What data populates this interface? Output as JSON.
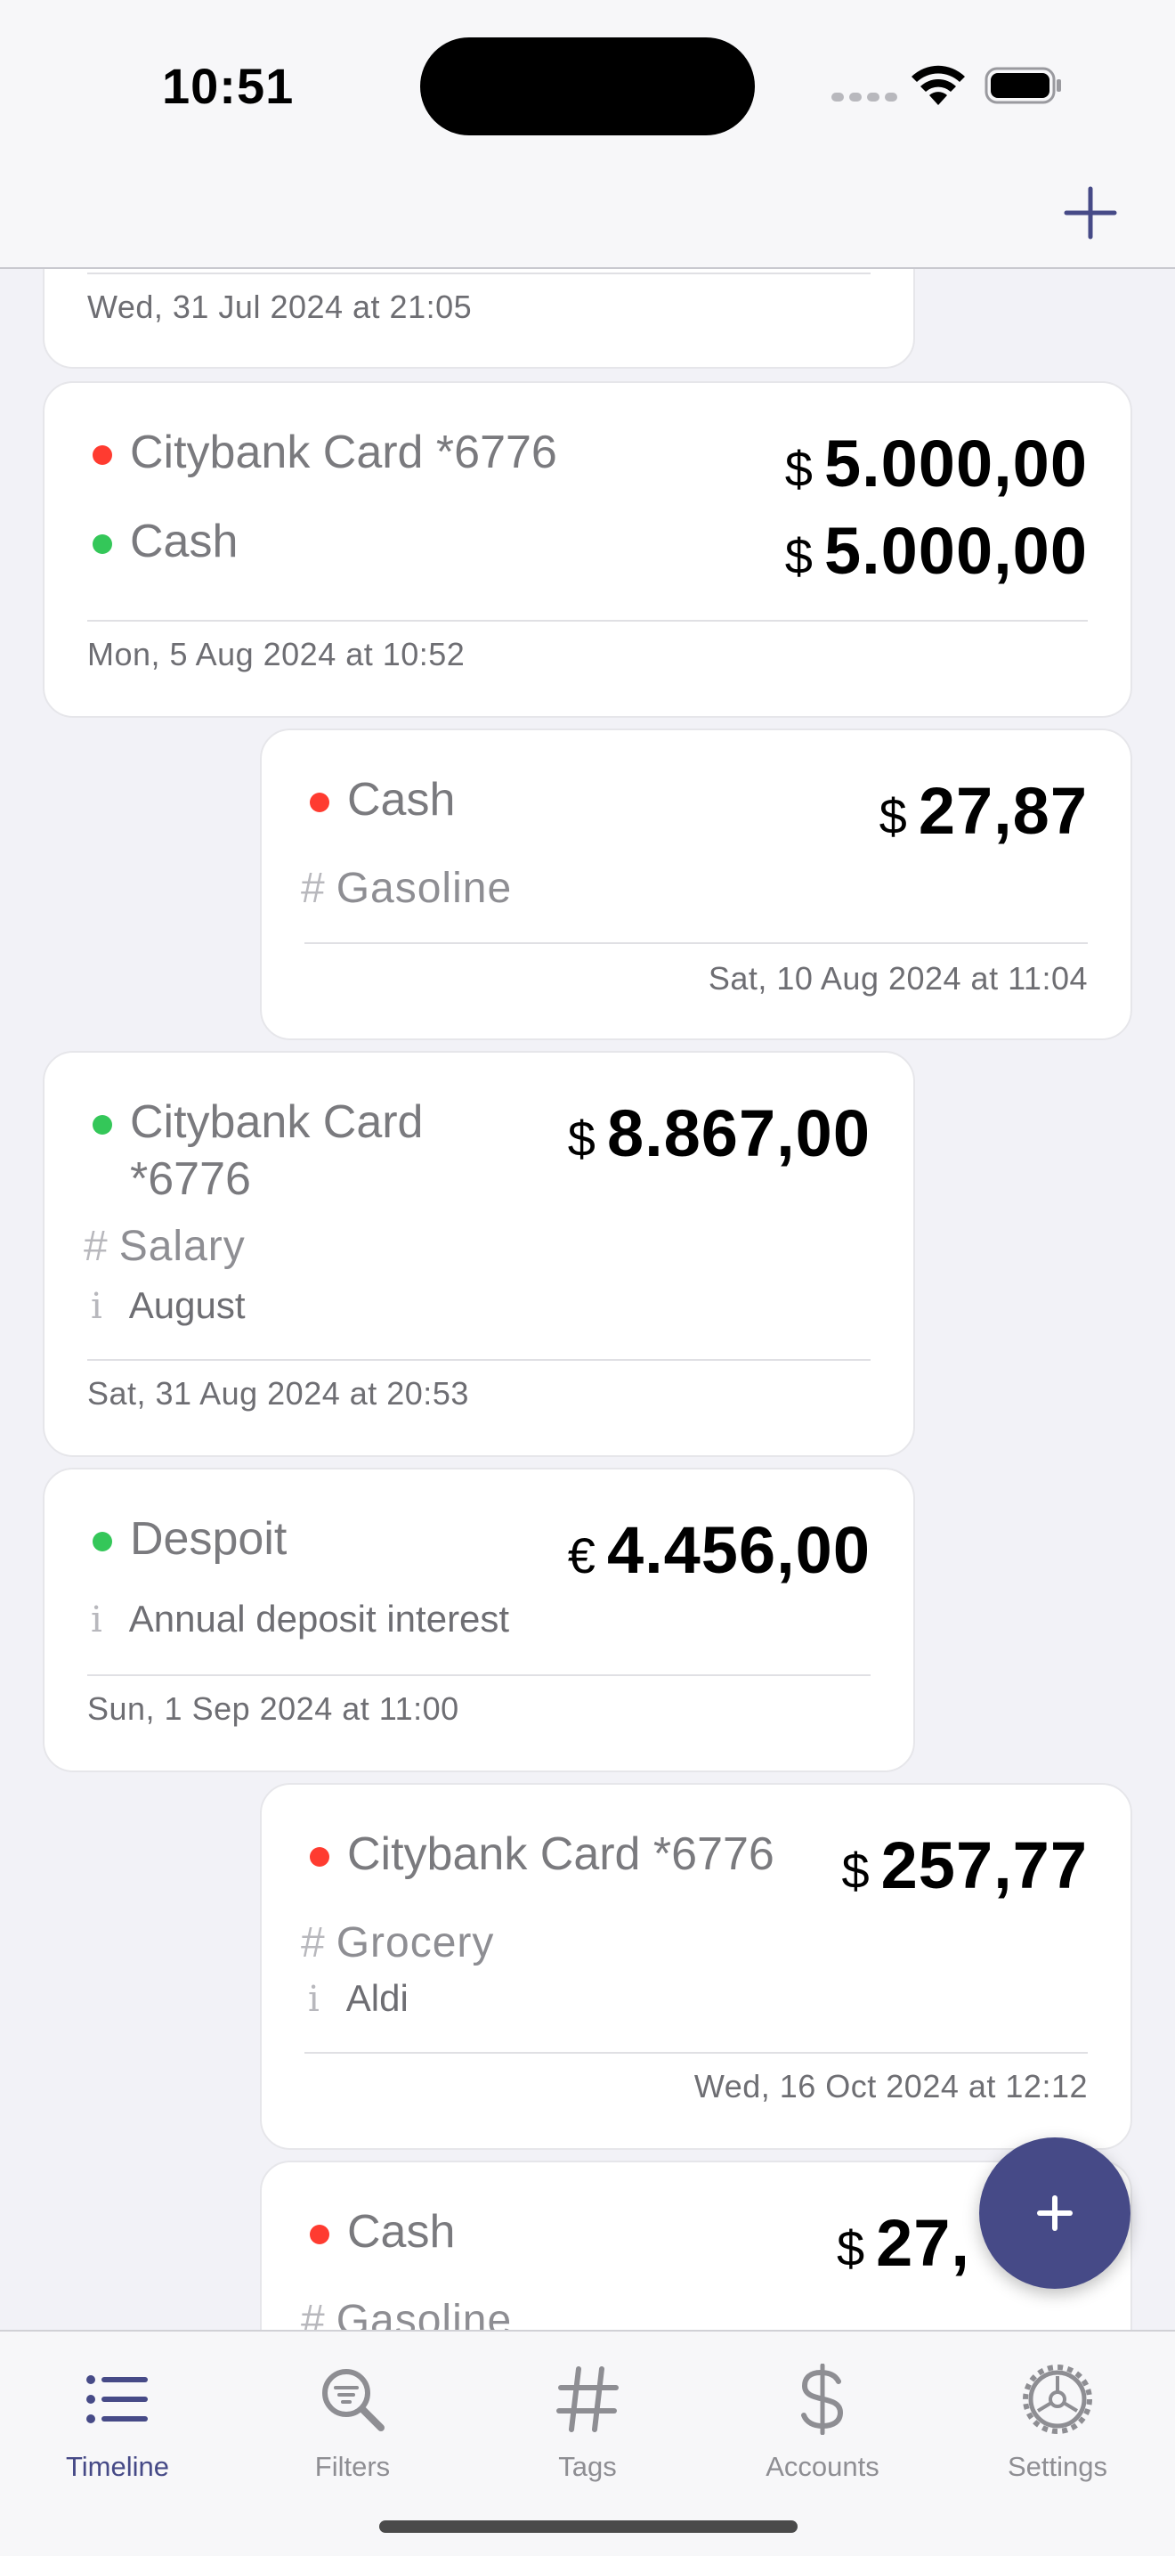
{
  "status": {
    "time": "10:51"
  },
  "nav": {
    "add_icon": "plus-icon"
  },
  "cards": [
    {
      "date": "Wed, 31 Jul 2024 at 21:05"
    },
    {
      "from_account": "Citybank Card *6776",
      "from_currency": "$",
      "from_amount": "5.000,00",
      "to_account": "Cash",
      "to_currency": "$",
      "to_amount": "5.000,00",
      "date": "Mon, 5 Aug 2024 at 10:52"
    },
    {
      "account": "Cash",
      "currency": "$",
      "amount": "27,87",
      "tag": "Gasoline",
      "date": "Sat, 10 Aug 2024 at 11:04"
    },
    {
      "account_line1": "Citybank Card",
      "account_line2": "*6776",
      "currency": "$",
      "amount": "8.867,00",
      "tag": "Salary",
      "note": "August",
      "date": "Sat, 31 Aug 2024 at 20:53"
    },
    {
      "account": "Despoit",
      "currency": "€",
      "amount": "4.456,00",
      "note": "Annual deposit interest",
      "date": "Sun, 1 Sep 2024 at 11:00"
    },
    {
      "account": "Citybank Card *6776",
      "currency": "$",
      "amount": "257,77",
      "tag": "Grocery",
      "note": "Aldi",
      "date": "Wed, 16 Oct 2024 at 12:12"
    },
    {
      "account": "Cash",
      "currency": "$",
      "amount": "27,",
      "tag": "Gasoline"
    }
  ],
  "symbols": {
    "hash": "#",
    "info": "i"
  },
  "colors": {
    "accent": "#464a87",
    "expense": "#ff3b30",
    "income": "#34c759"
  },
  "tabs": [
    {
      "label": "Timeline",
      "icon": "list-icon",
      "active": true
    },
    {
      "label": "Filters",
      "icon": "magnifier-filter-icon",
      "active": false
    },
    {
      "label": "Tags",
      "icon": "hashtag-icon",
      "active": false
    },
    {
      "label": "Accounts",
      "icon": "dollar-icon",
      "active": false
    },
    {
      "label": "Settings",
      "icon": "gear-icon",
      "active": false
    }
  ]
}
